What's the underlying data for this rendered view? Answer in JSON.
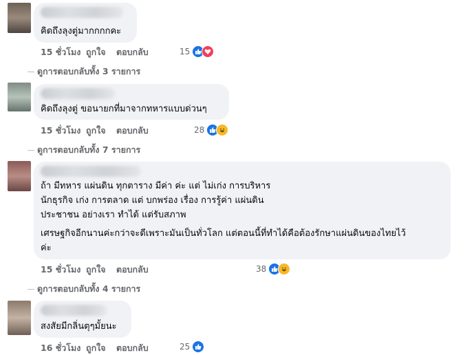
{
  "comments": [
    {
      "lines": [
        "คิดถึงลุงตู่มากกกกคะ"
      ],
      "time": "15 ชั่วโมง",
      "like_label": "ถูกใจ",
      "reply_label": "ตอบกลับ",
      "reaction_count": "15",
      "reactions": [
        "like-icon",
        "love-icon"
      ],
      "view_replies": "ดูการตอบกลับทั้ง 3 รายการ"
    },
    {
      "lines": [
        "คิดถึงลุงตู่ ขอนายกที่มาจากทหารแบบด่วนๆ"
      ],
      "time": "15 ชั่วโมง",
      "like_label": "ถูกใจ",
      "reply_label": "ตอบกลับ",
      "reaction_count": "28",
      "reactions": [
        "like-icon",
        "haha-icon"
      ],
      "view_replies": "ดูการตอบกลับทั้ง 7 รายการ"
    },
    {
      "lines": [
        "ถ้า มีทหาร แผ่นดิน ทุกตาราง มีค่า ค่ะ แต่ ไม่เก่ง การบริหาร",
        "นักธุรกิจ เก่ง การตลาด แต่ บกพร่อง เรื่อง การรู้ค่า แผ่นดิน",
        "ประชาชน อย่างเรา ทำได้ แต่รับสภาพ",
        "เศรษฐกิจอีกนานค่ะกว่าจะดีเพราะมันเป็นทั่วโลก แต่ตอนนี้ที่ทำได้คือต้องรักษาแผ่นดินของไทยไว้",
        "ค่ะ"
      ],
      "time": "15 ชั่วโมง",
      "like_label": "ถูกใจ",
      "reply_label": "ตอบกลับ",
      "reaction_count": "38",
      "reactions": [
        "like-icon",
        "haha-icon"
      ],
      "view_replies": "ดูการตอบกลับทั้ง 4 รายการ"
    },
    {
      "lines": [
        "สงสัยมีกลิ่นตุๆมั้ยนะ"
      ],
      "time": "16 ชั่วโมง",
      "like_label": "ถูกใจ",
      "reply_label": "ตอบกลับ",
      "reaction_count": "25",
      "reactions": [
        "like-icon"
      ]
    }
  ],
  "colors": {
    "bubble": "#f0f2f5",
    "meta_text": "#65676b",
    "like_blue": "#1b74e4",
    "love_red": "#f33e58",
    "haha_yellow": "#f7b928"
  }
}
